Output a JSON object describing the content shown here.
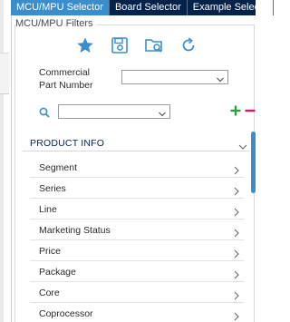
{
  "tabs": [
    {
      "label": "MCU/MPU Selector",
      "active": true
    },
    {
      "label": "Board Selector",
      "active": false
    },
    {
      "label": "Example Selecto",
      "active": false
    }
  ],
  "filters": {
    "group_title": "MCU/MPU Filters",
    "toolbar_icons": [
      "star-icon",
      "save-icon",
      "folder-search-icon",
      "reset-icon"
    ],
    "commercial_part_number_label_line1": "Commercial",
    "commercial_part_number_label_line2": "Part Number",
    "commercial_part_number_value": "",
    "search_value": ""
  },
  "product_info": {
    "header": "PRODUCT INFO",
    "items": [
      {
        "label": "Segment"
      },
      {
        "label": "Series"
      },
      {
        "label": "Line"
      },
      {
        "label": "Marketing Status"
      },
      {
        "label": "Price"
      },
      {
        "label": "Package"
      },
      {
        "label": "Core"
      },
      {
        "label": "Coprocessor"
      }
    ]
  },
  "colors": {
    "tab_bar": "#03234b",
    "tab_active": "#3c8dcb",
    "icon_blue": "#3c8dcb",
    "add_green": "#2ea043",
    "remove_pink": "#e0156f"
  }
}
